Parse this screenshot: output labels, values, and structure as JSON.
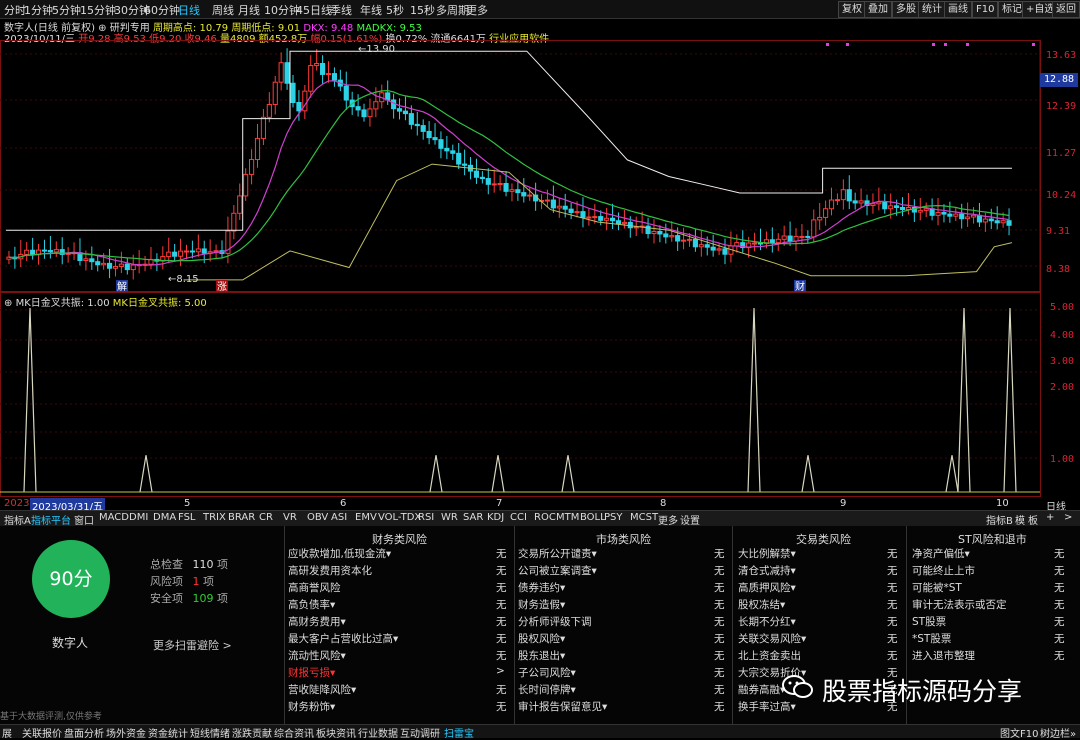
{
  "toolbar": {
    "periods": [
      "分时",
      "1分钟",
      "5分钟",
      "15分钟",
      "30分钟",
      "60分钟",
      "日线",
      "周线",
      "月线",
      "10分钟",
      "45日线",
      "季线",
      "年线",
      "5秒",
      "15秒",
      "多周期",
      "更多"
    ],
    "active_period": "日线",
    "right_buttons": [
      "复权",
      "叠加",
      "多股",
      "统计",
      "画线",
      "F10",
      "标记",
      "+自选",
      "返回"
    ]
  },
  "header": {
    "title": "数字人(日线 前复权)",
    "indicator_a": "研判专用",
    "cycle_high_label": "周期高点: 10.79",
    "cycle_low_label": "周期低点: 9.01",
    "dkx": "DKX: 9.48",
    "madkx": "MADKX: 9.53",
    "date": "2023/10/11/三",
    "open": "开9.28",
    "high": "高9.53",
    "low": "低9.20",
    "close": "收9.46",
    "volume": "量4809",
    "amount": "额452.8万",
    "change": "幅0.15(1.61%)",
    "turnover": "换0.72%",
    "float_cap": "流通6641万",
    "industry": "行业应用软件",
    "peak_label": "13.90",
    "trough_label": "8.15"
  },
  "price_axis": [
    "13.63",
    "12.88",
    "12.39",
    "11.27",
    "10.24",
    "9.31",
    "8.38"
  ],
  "current_price_tag": "12.88",
  "chart_markers": {
    "jie": "解",
    "zhang": "涨",
    "cai": "财"
  },
  "oscillator": {
    "title": "MK日金叉共振: 1.00",
    "title2": "MK日金叉共振: 5.00",
    "axis": [
      "5.00",
      "4.00",
      "3.00",
      "2.00",
      "1.00"
    ]
  },
  "time_axis": {
    "start": "2023/03/31/五",
    "months": [
      "5",
      "6",
      "7",
      "8",
      "9",
      "10"
    ],
    "period_button": "日线",
    "year_stub": "2023"
  },
  "indicator_tabs": [
    "指标A",
    "指标平台",
    "窗口",
    "MACD",
    "DMI",
    "DMA",
    "FSL",
    "TRIX",
    "BRAR",
    "CR",
    "VR",
    "OBV",
    "ASI",
    "EMV",
    "VOL-TDX",
    "RSI",
    "WR",
    "SAR",
    "KDJ",
    "CCI",
    "ROC",
    "MTM",
    "BOLL",
    "PSY",
    "MCST",
    "更多",
    "设置"
  ],
  "indicator_tabs_right": [
    "指标B",
    "模",
    "板",
    "+",
    ">"
  ],
  "risk": {
    "score": "90分",
    "name": "数字人",
    "total_label": "总检查",
    "total_val": "110",
    "total_unit": "项",
    "risk_label": "风险项",
    "risk_val": "1",
    "risk_unit": "项",
    "safe_label": "安全项",
    "safe_val": "109",
    "safe_unit": "项",
    "more": "更多扫雷避险 >",
    "footer": "基于大数据评测,仅供参考",
    "col1_title": "财务类风险",
    "col2_title": "市场类风险",
    "col3_title": "交易类风险",
    "col4_title": "ST风险和退市",
    "col1": [
      "应收款增加,低现金流▾",
      "高研发费用资本化",
      "高商誉风险",
      "高负债率▾",
      "高财务费用▾",
      "最大客户占营收比过高▾",
      "流动性风险▾",
      "财报亏损▾",
      "营收陡降风险▾",
      "财务粉饰▾"
    ],
    "col1_vals": [
      "无",
      "无",
      "无",
      "无",
      "无",
      "无",
      "无",
      ">",
      "无",
      "无"
    ],
    "col2": [
      "交易所公开谴责▾",
      "公司被立案调查▾",
      "债券违约▾",
      "财务造假▾",
      "分析师评级下调",
      "股权风险▾",
      "股东退出▾",
      "子公司风险▾",
      "长时间停牌▾",
      "审计报告保留意见▾"
    ],
    "col2_vals": [
      "无",
      "无",
      "无",
      "无",
      "无",
      "无",
      "无",
      "无",
      "无",
      "无"
    ],
    "col3": [
      "大比例解禁▾",
      "清仓式减持▾",
      "高质押风险▾",
      "股权冻结▾",
      "长期不分红▾",
      "关联交易风险▾",
      "北上资金卖出",
      "大宗交易折价▾",
      "融券高融▾",
      "换手率过高▾"
    ],
    "col3_vals": [
      "无",
      "无",
      "无",
      "无",
      "无",
      "无",
      "无",
      "无",
      "无",
      "无"
    ],
    "col4": [
      "净资产偏低▾",
      "可能终止上市",
      "可能被*ST",
      "审计无法表示或否定",
      "ST股票",
      "*ST股票",
      "进入退市整理"
    ],
    "col4_vals": [
      "无",
      "无",
      "无",
      "无",
      "无",
      "无",
      "无"
    ]
  },
  "watermark": "股票指标源码分享",
  "statusbar": {
    "items": [
      "展",
      "关联报价",
      "盘面分析",
      "场外资金",
      "资金统计",
      "短线情绪",
      "涨跌贡献",
      "综合资讯",
      "板块资讯",
      "行业数据",
      "互动调研",
      "扫雷宝"
    ],
    "active": "扫雷宝",
    "right": [
      "图文F10",
      "树边栏»"
    ]
  },
  "colors": {
    "up": "#ff3a3a",
    "down": "#2cd3e6",
    "ma_purple": "#d040d0",
    "ma_green": "#30c040",
    "band_white": "#f0f0f0",
    "band_yellow": "#c0c060",
    "score_green": "#22b35a"
  }
}
